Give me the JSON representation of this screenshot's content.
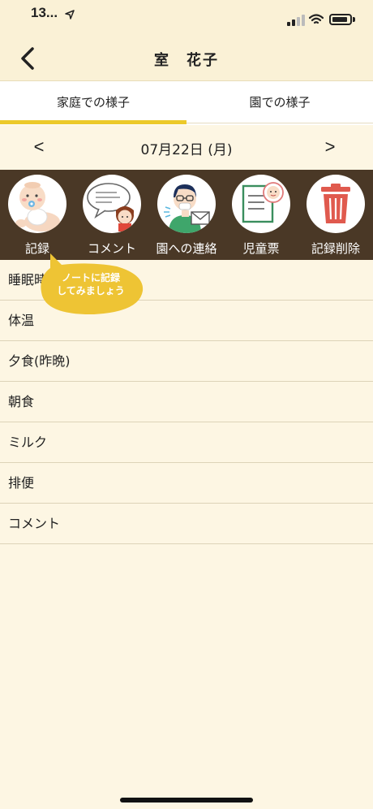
{
  "status_bar": {
    "time": "13...",
    "location_icon": "location-arrow-icon"
  },
  "header": {
    "title": "室　花子",
    "back_icon": "chevron-left-icon"
  },
  "tabs": [
    {
      "label": "家庭での様子",
      "active": true
    },
    {
      "label": "園での様子",
      "active": false
    }
  ],
  "date_nav": {
    "prev": "<",
    "date": "07月22日 (月)",
    "next": ">"
  },
  "actions": [
    {
      "label": "記録",
      "icon": "baby-icon"
    },
    {
      "label": "コメント",
      "icon": "comment-icon"
    },
    {
      "label": "園への連絡",
      "icon": "contact-icon"
    },
    {
      "label": "児童票",
      "icon": "child-record-icon"
    },
    {
      "label": "記録削除",
      "icon": "trash-icon"
    }
  ],
  "tooltip": {
    "line1": "ノートに記録",
    "line2": "してみましょう"
  },
  "records": [
    "睡眠時間",
    "体温",
    "夕食(昨晩)",
    "朝食",
    "ミルク",
    "排便",
    "コメント"
  ],
  "colors": {
    "accent": "#ecc92a",
    "action_bar": "#4a3826",
    "background": "#fdf6e3",
    "header": "#faf1d6"
  }
}
